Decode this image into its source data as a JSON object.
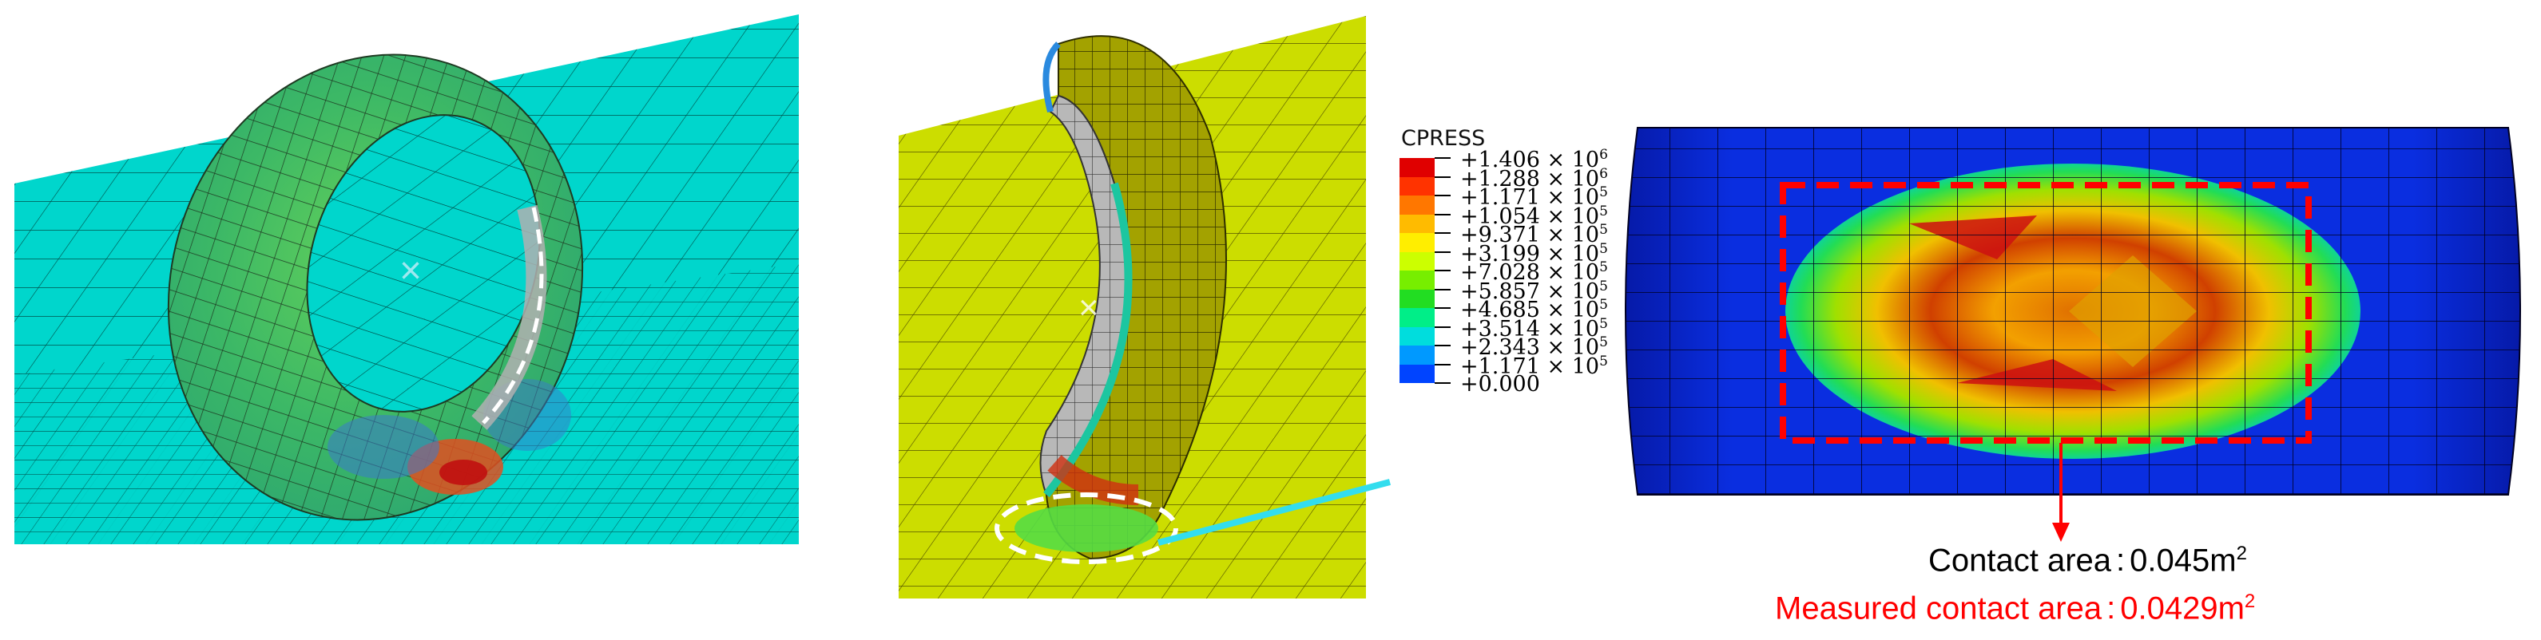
{
  "legend": {
    "title": "CPRESS",
    "entries": [
      {
        "label": "+1.406 × 10",
        "exp": "6",
        "color": "#e00000"
      },
      {
        "label": "+1.288 × 10",
        "exp": "6",
        "color": "#ff3300"
      },
      {
        "label": "+1.171 × 10",
        "exp": "5",
        "color": "#ff7700"
      },
      {
        "label": "+1.054 × 10",
        "exp": "5",
        "color": "#ffbb00"
      },
      {
        "label": "+9.371 × 10",
        "exp": "5",
        "color": "#ffee00"
      },
      {
        "label": "+3.199 × 10",
        "exp": "5",
        "color": "#ccff00"
      },
      {
        "label": "+7.028 × 10",
        "exp": "5",
        "color": "#77ee00"
      },
      {
        "label": "+5.857 × 10",
        "exp": "5",
        "color": "#22dd22"
      },
      {
        "label": "+4.685 × 10",
        "exp": "5",
        "color": "#00ee88"
      },
      {
        "label": "+3.514 × 10",
        "exp": "5",
        "color": "#00dddd"
      },
      {
        "label": "+2.343 × 10",
        "exp": "5",
        "color": "#0099ff"
      },
      {
        "label": "+1.171 × 10",
        "exp": "5",
        "color": "#0044ff"
      },
      {
        "label": "+0.000",
        "exp": "",
        "color": "#0000dd"
      }
    ]
  },
  "captions": {
    "contact_label": "Contact area",
    "contact_value": "0.045m",
    "contact_exp": "2",
    "measured_label": "Measured contact area",
    "measured_value": "0.0429m",
    "measured_exp": "2",
    "separator": ":"
  },
  "colors": {
    "ground_left": "#00d6cc",
    "ground_mid": "#ccdd00",
    "tire_green": "#4cc060",
    "tire_olive": "#a3a200",
    "highlight_dashed": "#ffffff",
    "measured_red": "#ff0000",
    "connector_cyan": "#33ddee",
    "drum_blue": "#0a2ee0"
  }
}
